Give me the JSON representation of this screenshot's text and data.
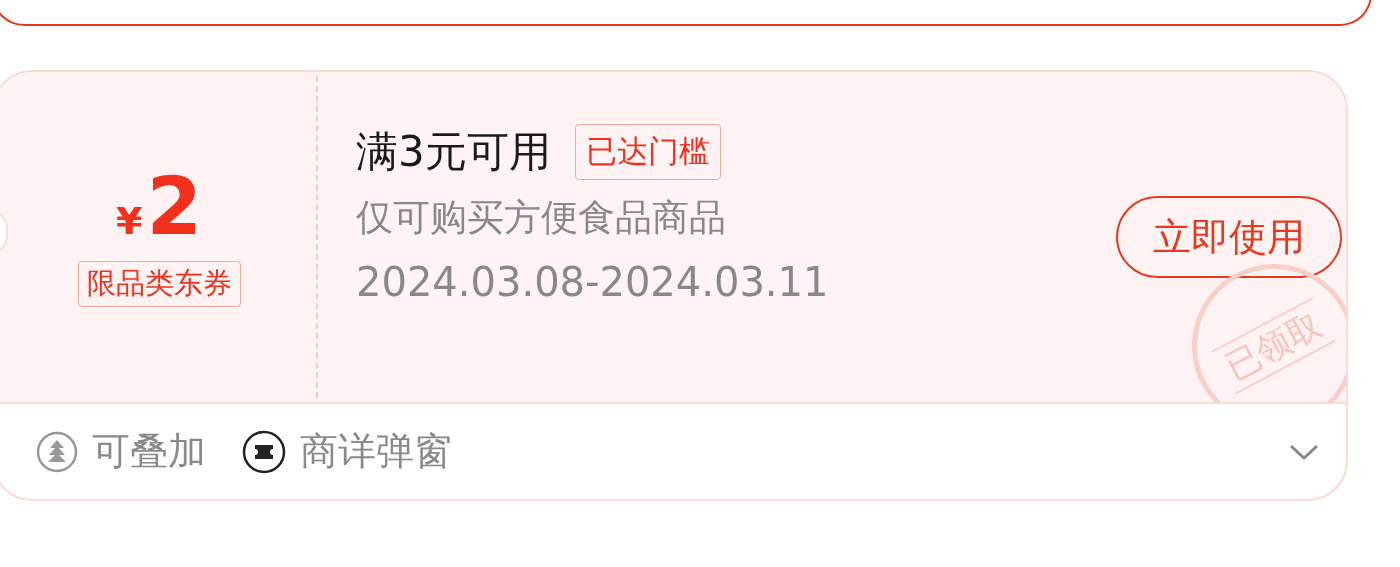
{
  "coupon": {
    "amount_symbol": "¥",
    "amount": "2",
    "category_tag": "限品类东券",
    "threshold": "满3元可用",
    "status_tag": "已达门槛",
    "scope": "仅可购买方便食品商品",
    "validity": "2024.03.08-2024.03.11",
    "action_button": "立即使用",
    "stamp": "已领取",
    "features": [
      {
        "kind": "stack",
        "label": "可叠加"
      },
      {
        "kind": "popup",
        "label": "商详弹窗"
      }
    ],
    "expanded": false
  }
}
